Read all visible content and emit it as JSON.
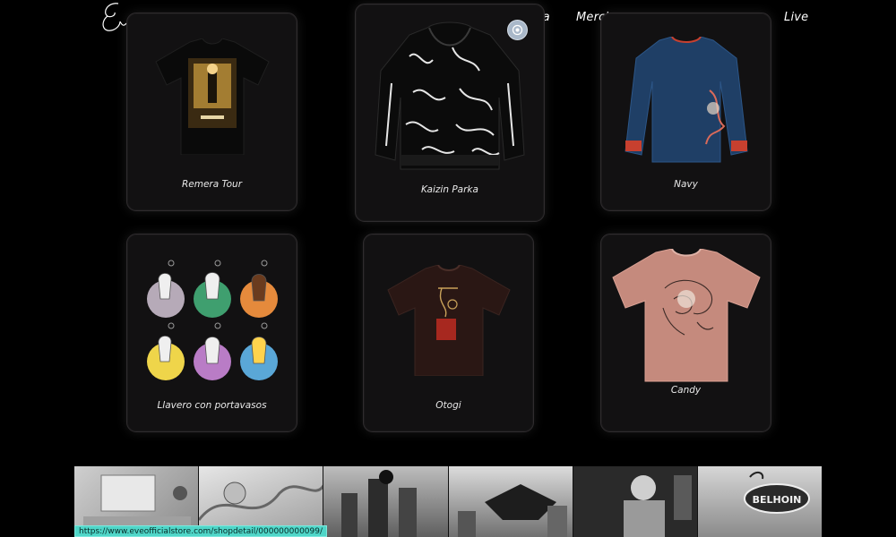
{
  "header": {
    "nav": [
      {
        "label": "fia"
      },
      {
        "label": "Merch"
      },
      {
        "label": "Live"
      }
    ]
  },
  "products": [
    {
      "name": "Remera Tour",
      "thumb_icon": "black-tshirt-poster-icon"
    },
    {
      "name": "Kaizin Parka",
      "thumb_icon": "black-hoodie-icon"
    },
    {
      "name": "Navy",
      "thumb_icon": "navy-longsleeve-icon"
    },
    {
      "name": "Llavero con portavasos",
      "thumb_icon": "keychain-set-icon"
    },
    {
      "name": "Otogi",
      "thumb_icon": "brown-tshirt-icon"
    },
    {
      "name": "Candy",
      "thumb_icon": "pink-tshirt-icon"
    }
  ],
  "gallery": {
    "tiles": [
      "gallery-image-1",
      "gallery-image-2",
      "gallery-image-3",
      "gallery-image-4",
      "gallery-image-5",
      "gallery-image-6"
    ],
    "sign_text": "BELHOIN"
  },
  "status_bar": {
    "url": "https://www.eveofficialstore.com/shopdetail/000000000099/"
  },
  "colors": {
    "background": "#000000",
    "card": "#121112",
    "accent_status": "#4fd6c8"
  }
}
